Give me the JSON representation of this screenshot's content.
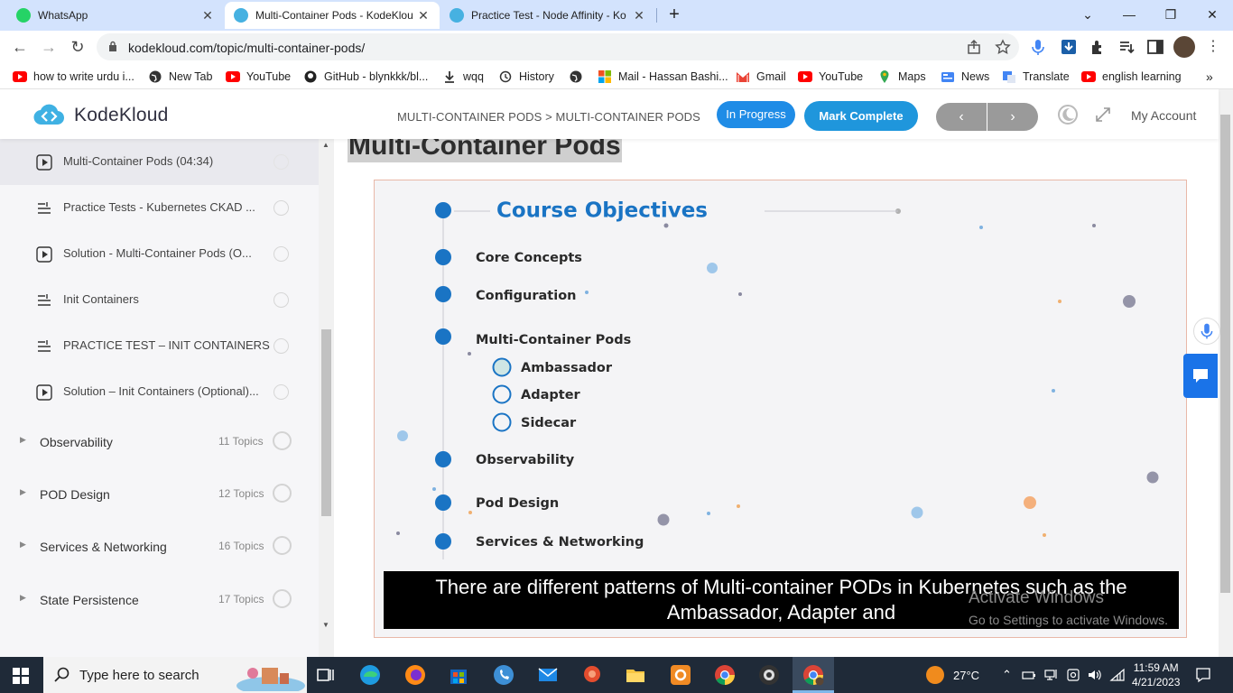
{
  "browser": {
    "tabs": [
      {
        "title": "WhatsApp",
        "close": "✕",
        "favicon_color": "#25d366",
        "active": false
      },
      {
        "title": "Multi-Container Pods - KodeKlou",
        "close": "✕",
        "favicon_color": "#46b1e1",
        "active": true
      },
      {
        "title": "Practice Test - Node Affinity - Ko",
        "close": "✕",
        "favicon_color": "#46b1e1",
        "active": false
      }
    ],
    "new_tab": "+",
    "window_controls": {
      "dropdown": "⌄",
      "minimize": "—",
      "restore": "❐",
      "close": "✕"
    },
    "nav": {
      "back": "←",
      "forward": "→",
      "reload": "↻"
    },
    "url": "kodekloud.com/topic/multi-container-pods/",
    "bookmarks": [
      {
        "label": "how to write urdu i...",
        "icon": "youtube-icon"
      },
      {
        "label": "New Tab",
        "icon": "globe-icon"
      },
      {
        "label": "YouTube",
        "icon": "youtube-icon"
      },
      {
        "label": "GitHub - blynkkk/bl...",
        "icon": "github-icon"
      },
      {
        "label": "wqq",
        "icon": "download-icon"
      },
      {
        "label": "History",
        "icon": "history-icon"
      },
      {
        "label": "",
        "icon": "globe-icon"
      },
      {
        "label": "Mail - Hassan Bashi...",
        "icon": "microsoft-icon"
      },
      {
        "label": "Gmail",
        "icon": "gmail-icon"
      },
      {
        "label": "YouTube",
        "icon": "youtube-icon"
      },
      {
        "label": "Maps",
        "icon": "maps-icon"
      },
      {
        "label": "News",
        "icon": "news-icon"
      },
      {
        "label": "Translate",
        "icon": "translate-icon"
      },
      {
        "label": "english learning",
        "icon": "youtube-icon"
      }
    ],
    "bookmarks_more": "»"
  },
  "header": {
    "brand": "KodeKloud",
    "breadcrumb": "MULTI-CONTAINER PODS > MULTI-CONTAINER PODS",
    "status_button": "In Progress",
    "complete_button": "Mark Complete",
    "prev": "‹",
    "next": "›",
    "account": "My Account"
  },
  "sidebar": {
    "lessons": [
      {
        "label": "Multi-Container Pods (04:34)",
        "icon": "play-icon",
        "active": true
      },
      {
        "label": "Practice Tests - Kubernetes CKAD ...",
        "icon": "list-icon",
        "active": false
      },
      {
        "label": "Solution - Multi-Container Pods (O...",
        "icon": "play-icon",
        "active": false
      },
      {
        "label": "Init Containers",
        "icon": "list-icon",
        "active": false
      },
      {
        "label": "PRACTICE TEST – INIT CONTAINERS",
        "icon": "list-icon",
        "active": false
      },
      {
        "label": "Solution – Init Containers (Optional)...",
        "icon": "play-icon",
        "active": false
      }
    ],
    "sections": [
      {
        "label": "Observability",
        "count": "11 Topics"
      },
      {
        "label": "POD Design",
        "count": "12 Topics"
      },
      {
        "label": "Services & Networking",
        "count": "16 Topics"
      },
      {
        "label": "State Persistence",
        "count": "17 Topics"
      }
    ]
  },
  "content": {
    "title": "Multi-Container Pods",
    "slide": {
      "heading": "Course Objectives",
      "items": [
        "Core Concepts",
        "Configuration",
        "Multi-Container Pods"
      ],
      "subitems": [
        "Ambassador",
        "Adapter",
        "Sidecar"
      ],
      "items_after": [
        "Observability",
        "Pod Design",
        "Services & Networking"
      ]
    },
    "caption_line1": "There are different patterns of Multi-container PODs in Kubernetes such as the",
    "caption_line2": "Ambassador, Adapter and",
    "watermark_line1": "Activate Windows",
    "watermark_line2": "Go to Settings to activate Windows."
  },
  "taskbar": {
    "search_placeholder": "Type here to search",
    "weather": "27°C",
    "time": "11:59 AM",
    "date": "4/21/2023"
  },
  "colors": {
    "accent": "#1f8ce6",
    "slide_blue": "#1a74c4",
    "tabstrip": "#d3e3fd",
    "taskbar": "#1f2a38"
  }
}
